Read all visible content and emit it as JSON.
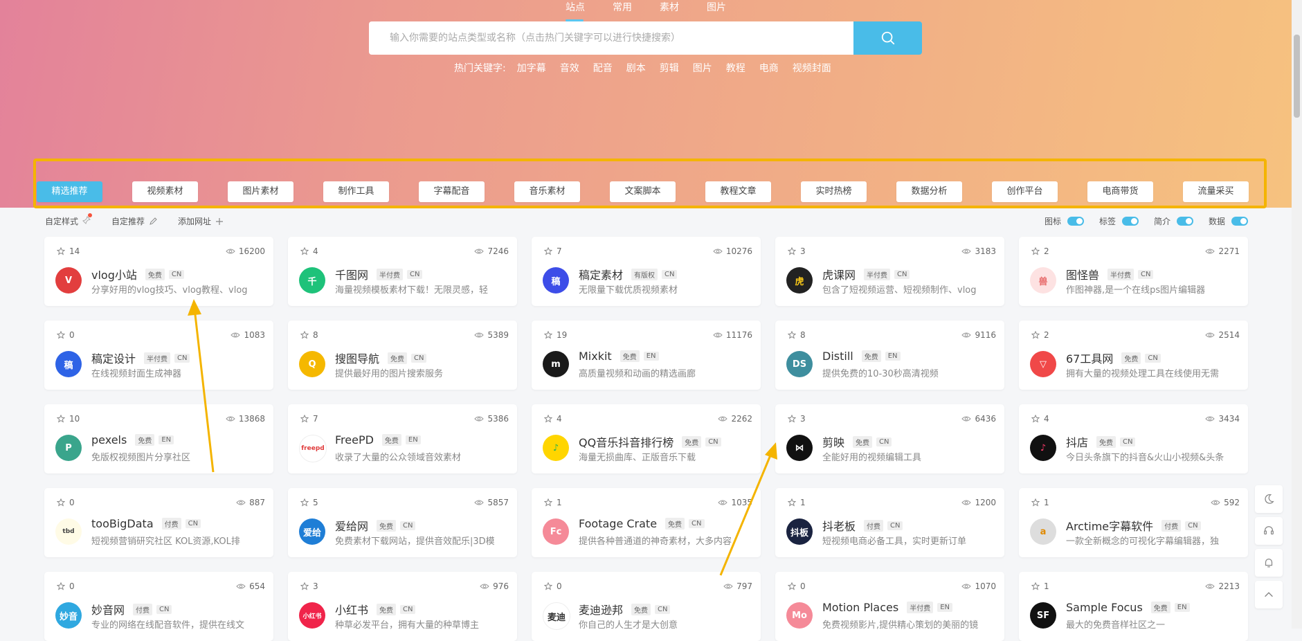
{
  "top_tabs": [
    "站点",
    "常用",
    "素材",
    "图片"
  ],
  "search": {
    "placeholder": "输入你需要的站点类型或名称（点击热门关键字可以进行快捷搜索）",
    "button_icon": "search-icon"
  },
  "hot": {
    "label": "热门关键字:",
    "keywords": [
      "加字幕",
      "音效",
      "配音",
      "剧本",
      "剪辑",
      "图片",
      "教程",
      "电商",
      "视频封面"
    ]
  },
  "categories": [
    "精选推荐",
    "视频素材",
    "图片素材",
    "制作工具",
    "字幕配音",
    "音乐素材",
    "文案脚本",
    "教程文章",
    "实时热榜",
    "数据分析",
    "创作平台",
    "电商带货",
    "流量采买"
  ],
  "toolbar": {
    "custom_style": "自定样式",
    "custom_recommend": "自定推荐",
    "add_site": "添加网址"
  },
  "toggles": [
    "图标",
    "标签",
    "简介",
    "数据"
  ],
  "colors": {
    "accent": "#49bce8",
    "highlight": "#f4b400"
  },
  "cards": [
    {
      "stars": "14",
      "views": "16200",
      "name": "vlog小站",
      "tags": [
        "免费",
        "CN"
      ],
      "desc": "分享好用的vlog技巧、vlog教程、vlog",
      "logo": "V",
      "logo_bg": "#e23e3e",
      "logo_fg": "#ffffff"
    },
    {
      "stars": "4",
      "views": "7246",
      "name": "千图网",
      "tags": [
        "半付费",
        "CN"
      ],
      "desc": "海量视频模板素材下载！无限灵感，轻",
      "logo": "千",
      "logo_bg": "#1ec27a",
      "logo_fg": "#ffffff"
    },
    {
      "stars": "7",
      "views": "10276",
      "name": "稿定素材",
      "tags": [
        "有版权",
        "CN"
      ],
      "desc": "无限量下载优质视频素材",
      "logo": "稿",
      "logo_bg": "#3d4de8",
      "logo_fg": "#ffffff"
    },
    {
      "stars": "3",
      "views": "3183",
      "name": "虎课网",
      "tags": [
        "半付费",
        "CN"
      ],
      "desc": "包含了短视频运营、短视频制作、vlog",
      "logo": "虎",
      "logo_bg": "#222222",
      "logo_fg": "#f5c518"
    },
    {
      "stars": "2",
      "views": "2271",
      "name": "图怪兽",
      "tags": [
        "半付费",
        "CN"
      ],
      "desc": "作图神器,是一个在线ps图片编辑器",
      "logo": "兽",
      "logo_bg": "#fde2e2",
      "logo_fg": "#e86d6d"
    },
    {
      "stars": "0",
      "views": "1083",
      "name": "稿定设计",
      "tags": [
        "半付费",
        "CN"
      ],
      "desc": "在线视频封面生成神器",
      "logo": "稿",
      "logo_bg": "#2e63e6",
      "logo_fg": "#ffffff"
    },
    {
      "stars": "8",
      "views": "5389",
      "name": "搜图导航",
      "tags": [
        "免费",
        "CN"
      ],
      "desc": "提供最好用的图片搜索服务",
      "logo": "Q",
      "logo_bg": "#f5b800",
      "logo_fg": "#ffffff"
    },
    {
      "stars": "19",
      "views": "11176",
      "name": "Mixkit",
      "tags": [
        "免费",
        "EN"
      ],
      "desc": "高质量视频和动画的精选画廊",
      "logo": "m",
      "logo_bg": "#1a1a1a",
      "logo_fg": "#ffffff"
    },
    {
      "stars": "8",
      "views": "9116",
      "name": "Distill",
      "tags": [
        "免费",
        "EN"
      ],
      "desc": "提供免费的10-30秒高清视频",
      "logo": "DS",
      "logo_bg": "#3e8e9e",
      "logo_fg": "#ffffff"
    },
    {
      "stars": "2",
      "views": "2514",
      "name": "67工具网",
      "tags": [
        "免费",
        "CN"
      ],
      "desc": "拥有大量的视频处理工具在线使用无需",
      "logo": "▽",
      "logo_bg": "#f04848",
      "logo_fg": "#ffffff"
    },
    {
      "stars": "10",
      "views": "13868",
      "name": "pexels",
      "tags": [
        "免费",
        "EN"
      ],
      "desc": "免版权视频图片分享社区",
      "logo": "P",
      "logo_bg": "#3aa58c",
      "logo_fg": "#ffffff"
    },
    {
      "stars": "7",
      "views": "5386",
      "name": "FreePD",
      "tags": [
        "免费",
        "EN"
      ],
      "desc": "收录了大量的公众领域音效素材",
      "logo": "freepd",
      "logo_bg": "#ffffff",
      "logo_fg": "#e03b3b"
    },
    {
      "stars": "4",
      "views": "2262",
      "name": "QQ音乐抖音排行榜",
      "tags": [
        "免费",
        "CN"
      ],
      "desc": "海量无损曲库、正版音乐下载",
      "logo": "♪",
      "logo_bg": "#ffd500",
      "logo_fg": "#2bb24c"
    },
    {
      "stars": "3",
      "views": "6436",
      "name": "剪映",
      "tags": [
        "免费",
        "CN"
      ],
      "desc": "全能好用的视频编辑工具",
      "logo": "⋈",
      "logo_bg": "#111111",
      "logo_fg": "#ffffff"
    },
    {
      "stars": "4",
      "views": "3434",
      "name": "抖店",
      "tags": [
        "免费",
        "CN"
      ],
      "desc": "今日头条旗下的抖音&火山小视频&头条",
      "logo": "♪",
      "logo_bg": "#111111",
      "logo_fg": "#ff3b6b"
    },
    {
      "stars": "0",
      "views": "887",
      "name": "tooBigData",
      "tags": [
        "付费",
        "CN"
      ],
      "desc": "短视频营销研究社区 KOL资源,KOL排",
      "logo": "tbd",
      "logo_bg": "#fffbe6",
      "logo_fg": "#444444"
    },
    {
      "stars": "5",
      "views": "5857",
      "name": "爱给网",
      "tags": [
        "免费",
        "CN"
      ],
      "desc": "免费素材下载网站，提供音效配乐|3D模",
      "logo": "爱给",
      "logo_bg": "#1f7ed6",
      "logo_fg": "#ffffff"
    },
    {
      "stars": "1",
      "views": "1035",
      "name": "Footage Crate",
      "tags": [
        "免费",
        "CN"
      ],
      "desc": "提供各种普通道的神奇素材，大多内容",
      "logo": "Fc",
      "logo_bg": "#f58a98",
      "logo_fg": "#ffffff"
    },
    {
      "stars": "1",
      "views": "1200",
      "name": "抖老板",
      "tags": [
        "付费",
        "CN"
      ],
      "desc": "短视频电商必备工具，实时更新订单",
      "logo": "抖板",
      "logo_bg": "#1a2340",
      "logo_fg": "#ffffff"
    },
    {
      "stars": "1",
      "views": "592",
      "name": "Arctime字幕软件",
      "tags": [
        "付费",
        "CN"
      ],
      "desc": "一款全新概念的可视化字幕编辑器，独",
      "logo": "a",
      "logo_bg": "#dddddd",
      "logo_fg": "#e08a00"
    },
    {
      "stars": "0",
      "views": "654",
      "name": "妙音网",
      "tags": [
        "付费",
        "CN"
      ],
      "desc": "专业的网络在线配音软件，提供在线文",
      "logo": "妙音",
      "logo_bg": "#2fa8e0",
      "logo_fg": "#ffffff"
    },
    {
      "stars": "3",
      "views": "976",
      "name": "小红书",
      "tags": [
        "免费",
        "CN"
      ],
      "desc": "种草必发平台，拥有大量的种草博主",
      "logo": "小红书",
      "logo_bg": "#f0244a",
      "logo_fg": "#ffffff"
    },
    {
      "stars": "0",
      "views": "797",
      "name": "麦迪逊邦",
      "tags": [
        "免费",
        "CN"
      ],
      "desc": "你自己的人生才是大创意",
      "logo": "麦迪",
      "logo_bg": "#ffffff",
      "logo_fg": "#333333"
    },
    {
      "stars": "0",
      "views": "1070",
      "name": "Motion Places",
      "tags": [
        "半付费",
        "EN"
      ],
      "desc": "免费视频影片,提供精心策划的美丽的镜",
      "logo": "Mo",
      "logo_bg": "#f58a98",
      "logo_fg": "#ffffff"
    },
    {
      "stars": "1",
      "views": "2213",
      "name": "Sample Focus",
      "tags": [
        "免费",
        "EN"
      ],
      "desc": "最大的免费音样社区之一",
      "logo": "SF",
      "logo_bg": "#111111",
      "logo_fg": "#ffffff"
    }
  ]
}
